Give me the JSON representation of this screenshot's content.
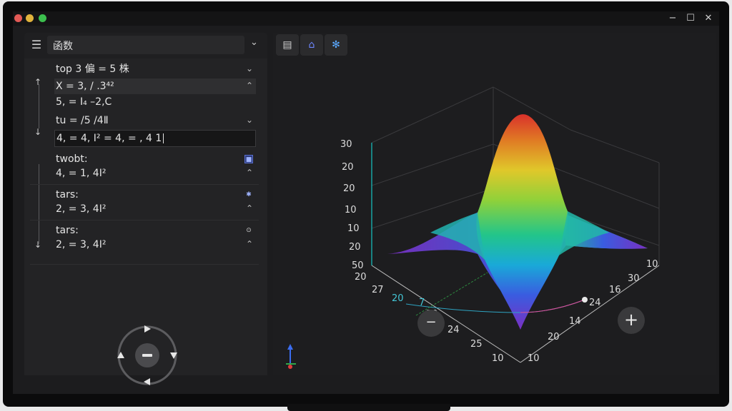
{
  "app": {
    "search_value": "函数"
  },
  "toolbar": {
    "buttons": [
      "folder-icon",
      "home-icon",
      "settings-icon"
    ]
  },
  "expressions": [
    {
      "text": "top 3 偏 = 5 株"
    },
    {
      "text": "X = 3, / .3⁴²"
    },
    {
      "text": "5, = I₄ –2,C"
    },
    {
      "text": "tu = /5 /4Ⅱ"
    },
    {
      "text": "4, = 4, I² = 4, = , 4 1"
    },
    {
      "label": "twobt:",
      "value": "4, = 1, 4I²"
    },
    {
      "label": "tars:",
      "value": "2, = 3, 4I²"
    },
    {
      "label": "tars:",
      "value": "2, = 3, 4I²"
    }
  ],
  "chart_data": {
    "type": "surface3d",
    "z_ticks": [
      "30",
      "20",
      "20",
      "10",
      "10",
      "20",
      "50"
    ],
    "x_ticks": [
      "20",
      "27",
      "20",
      "7",
      "20",
      "24",
      "25",
      "10"
    ],
    "y_ticks": [
      "10",
      "10",
      "30",
      "16",
      "24",
      "14",
      "20",
      "10"
    ],
    "colormap": [
      "#7a2fc2",
      "#3a5ce0",
      "#19a9d8",
      "#22c58a",
      "#8fd13a",
      "#e0c82a",
      "#e07a24",
      "#d9312b"
    ]
  },
  "nav": {
    "zoom_out": "−",
    "zoom_in": "+"
  }
}
